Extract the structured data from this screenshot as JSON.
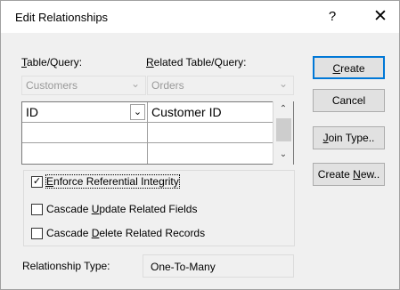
{
  "dialog": {
    "title": "Edit Relationships",
    "help_glyph": "?",
    "close_glyph": "✕"
  },
  "labels": {
    "table_query": "Table/Query:",
    "related_table_query": "Related Table/Query:"
  },
  "combos": {
    "table": {
      "value": "Customers"
    },
    "related_table": {
      "value": "Orders"
    }
  },
  "grid": {
    "rows": [
      {
        "left": "ID",
        "right": "Customer ID"
      },
      {
        "left": "",
        "right": ""
      },
      {
        "left": "",
        "right": ""
      }
    ]
  },
  "buttons": {
    "create": "Create",
    "cancel": "Cancel",
    "join_type": "Join Type..",
    "create_new": "Create New.."
  },
  "options": {
    "enforce": {
      "label": "Enforce Referential Integrity",
      "checked": true
    },
    "cascade_update": {
      "label": "Cascade Update Related Fields",
      "checked": false
    },
    "cascade_delete": {
      "label": "Cascade Delete Related Records",
      "checked": false
    }
  },
  "relationship": {
    "label": "Relationship Type:",
    "value": "One-To-Many"
  },
  "icons": {
    "dropdown": "chevron-down-icon",
    "scroll_up": "arrow-up-icon",
    "scroll_down": "arrow-down-icon",
    "check": "checkmark-icon"
  }
}
